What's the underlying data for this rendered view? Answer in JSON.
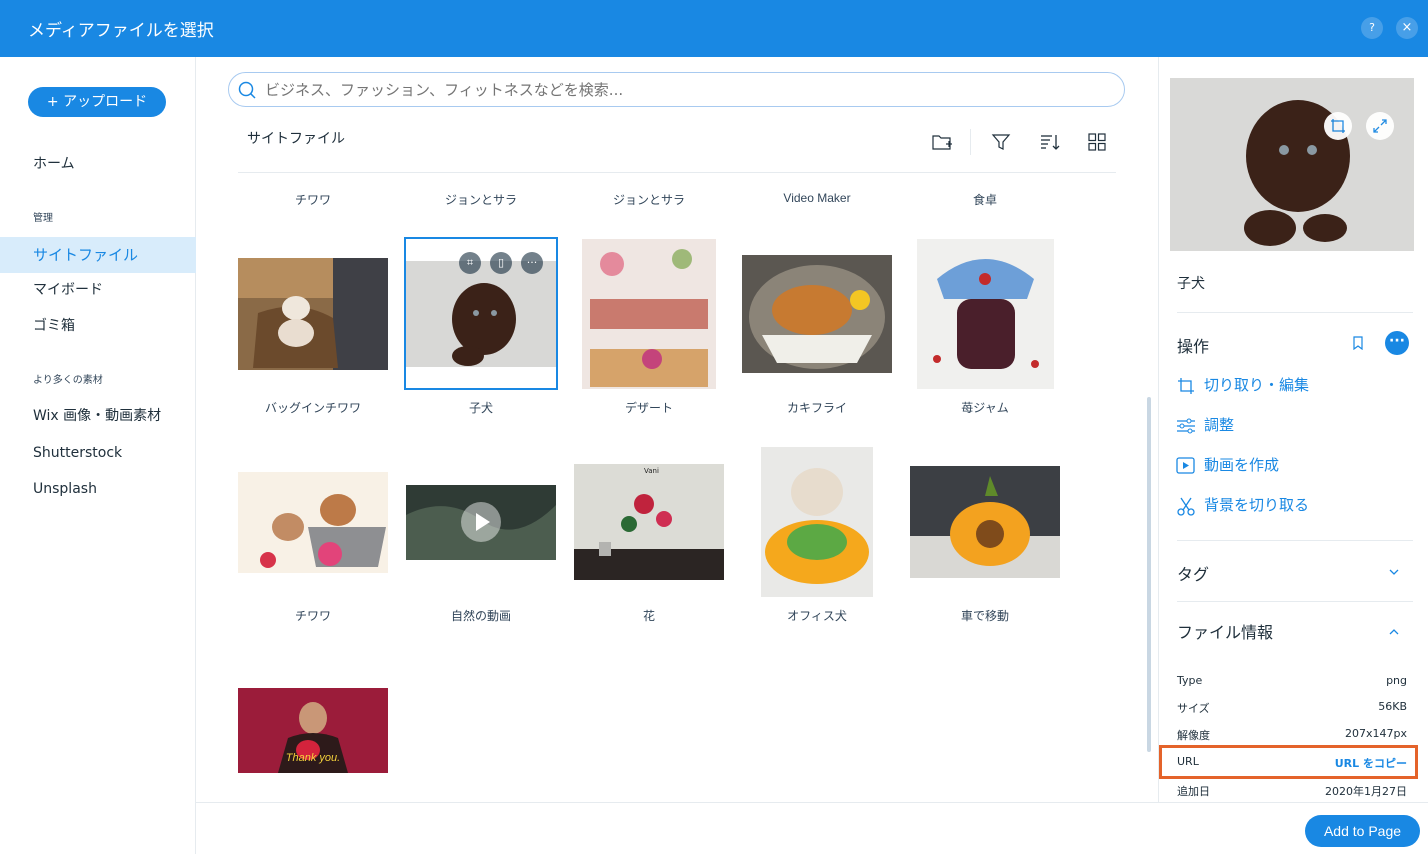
{
  "header": {
    "title": "メディアファイルを選択",
    "help_label": "?",
    "close_label": "×"
  },
  "sidebar": {
    "upload_label": "+ アップロード",
    "home": "ホーム",
    "section_manage": "管理",
    "items_manage": [
      "サイトファイル",
      "マイボード",
      "ゴミ箱"
    ],
    "section_more": "より多くの素材",
    "items_more": [
      "Wix 画像・動画素材",
      "Shutterstock",
      "Unsplash"
    ]
  },
  "search": {
    "placeholder": "ビジネス、ファッション、フィットネスなどを検索..."
  },
  "main": {
    "section_title": "サイトファイル",
    "top_row_captions": [
      "チワワ",
      "ジョンとサラ",
      "ジョンとサラ",
      "Video Maker",
      "食卓"
    ],
    "row1_captions": [
      "バッグインチワワ",
      "子犬",
      "デザート",
      "カキフライ",
      "苺ジャム"
    ],
    "row2_captions": [
      "チワワ",
      "自然の動画",
      "花",
      "オフィス犬",
      "車で移動"
    ],
    "thank_you_text": "Thank you.",
    "flower_tag": "Vani"
  },
  "right_panel": {
    "file_name": "子犬",
    "actions_title": "操作",
    "actions": [
      "切り取り・編集",
      "調整",
      "動画を作成",
      "背景を切り取る"
    ],
    "tags_title": "タグ",
    "file_info_title": "ファイル情報",
    "info": [
      {
        "key": "Type",
        "value": "png"
      },
      {
        "key": "サイズ",
        "value": "56KB"
      },
      {
        "key": "解像度",
        "value": "207x147px"
      },
      {
        "key": "URL",
        "value": "URL をコピー"
      },
      {
        "key": "追加日",
        "value": "2020年1月27日"
      }
    ]
  },
  "footer": {
    "add_label": "Add to Page"
  },
  "colors": {
    "accent": "#1988e3",
    "highlight": "#e4632a",
    "selected_bg": "#d8ecfb"
  }
}
